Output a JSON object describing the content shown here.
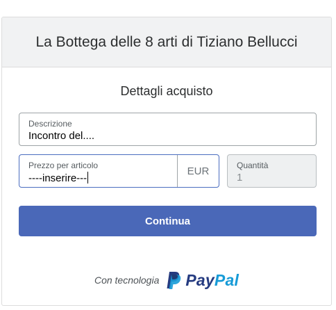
{
  "header": {
    "title": "La Bottega delle 8 arti di Tiziano Bellucci"
  },
  "form": {
    "section_title": "Dettagli acquisto",
    "description": {
      "label": "Descrizione",
      "value": "Incontro del...."
    },
    "price": {
      "label": "Prezzo per articolo",
      "value": "----inserire---",
      "currency": "EUR"
    },
    "quantity": {
      "label": "Quantità",
      "value": "1"
    },
    "continue_label": "Continua"
  },
  "footer": {
    "powered_by": "Con tecnologia",
    "brand_pay": "Pay",
    "brand_pal": "Pal"
  },
  "colors": {
    "accent": "#4a68b8",
    "paypal_dark": "#253b80",
    "paypal_light": "#179bd7"
  },
  "icons": {
    "brand": "paypal-logo-icon"
  }
}
